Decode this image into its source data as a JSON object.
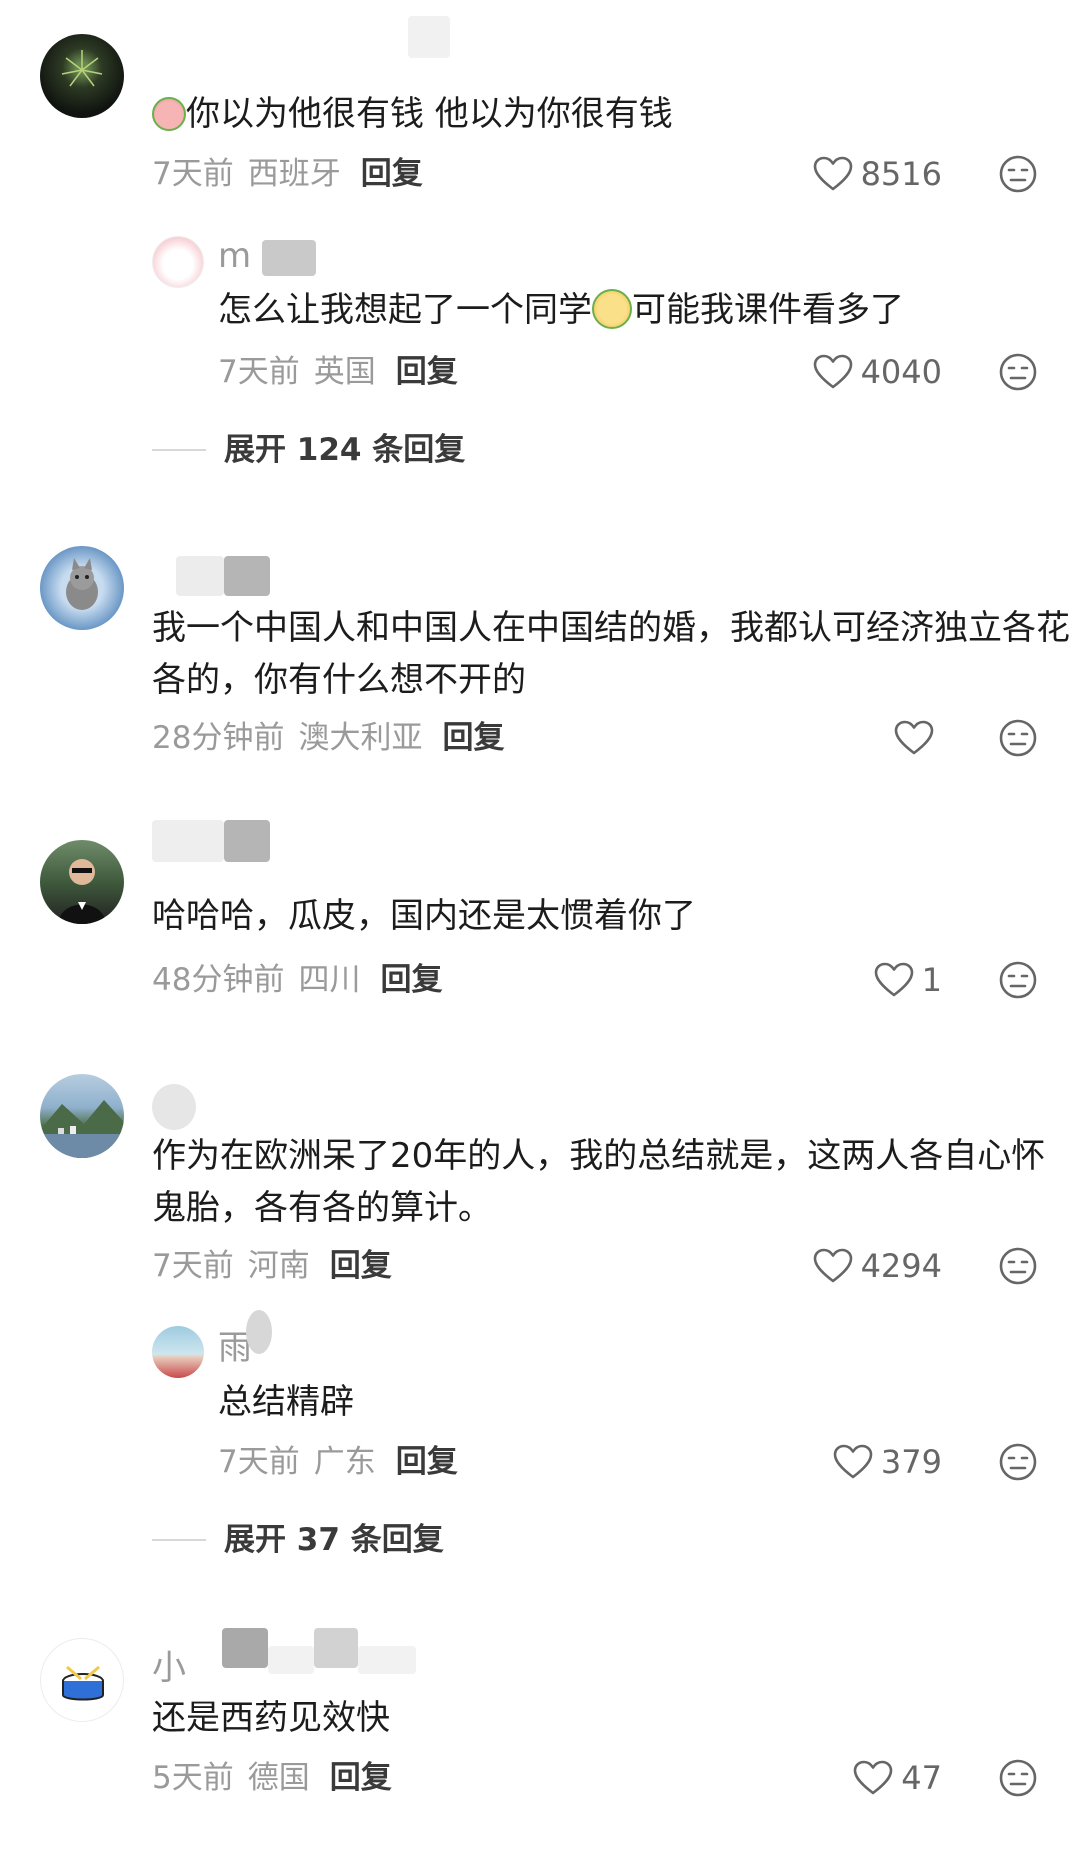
{
  "comments": [
    {
      "name": "",
      "text_prefix_emoji": "crying-laughing-emoji",
      "text": "你以为他很有钱 他以为你很有钱",
      "time": "7天前",
      "location": "西班牙",
      "reply_label": "回复",
      "likes": "8516",
      "replies": [
        {
          "name": "m",
          "text_a": "怎么让我想起了一个同学",
          "text_emoji": "meerkat-emoji",
          "text_b": "可能我课件看多了",
          "time": "7天前",
          "location": "英国",
          "reply_label": "回复",
          "likes": "4040"
        }
      ],
      "expand_label": "展开 124 条回复"
    },
    {
      "name": "",
      "text": "我一个中国人和中国人在中国结的婚，我都认可经济独立各花各的，你有什么想不开的",
      "time": "28分钟前",
      "location": "澳大利亚",
      "reply_label": "回复",
      "likes": ""
    },
    {
      "name": "",
      "text": "哈哈哈，瓜皮，国内还是太惯着你了",
      "time": "48分钟前",
      "location": "四川",
      "reply_label": "回复",
      "likes": "1"
    },
    {
      "name": "",
      "text": "作为在欧洲呆了20年的人，我的总结就是，这两人各自心怀鬼胎，各有各的算计。",
      "time": "7天前",
      "location": "河南",
      "reply_label": "回复",
      "likes": "4294",
      "replies": [
        {
          "name": "雨",
          "text": "总结精辟",
          "time": "7天前",
          "location": "广东",
          "reply_label": "回复",
          "likes": "379"
        }
      ],
      "expand_label": "展开 37 条回复"
    },
    {
      "name": "小",
      "text": "还是西药见效快",
      "time": "5天前",
      "location": "德国",
      "reply_label": "回复",
      "likes": "47"
    }
  ],
  "icons": {
    "like": "heart-outline-icon",
    "dislike": "neutral-face-icon"
  },
  "colors": {
    "meta_gray": "#9a9a9a",
    "text": "#1c1c1c",
    "reply_dark": "#3a3a3a"
  }
}
